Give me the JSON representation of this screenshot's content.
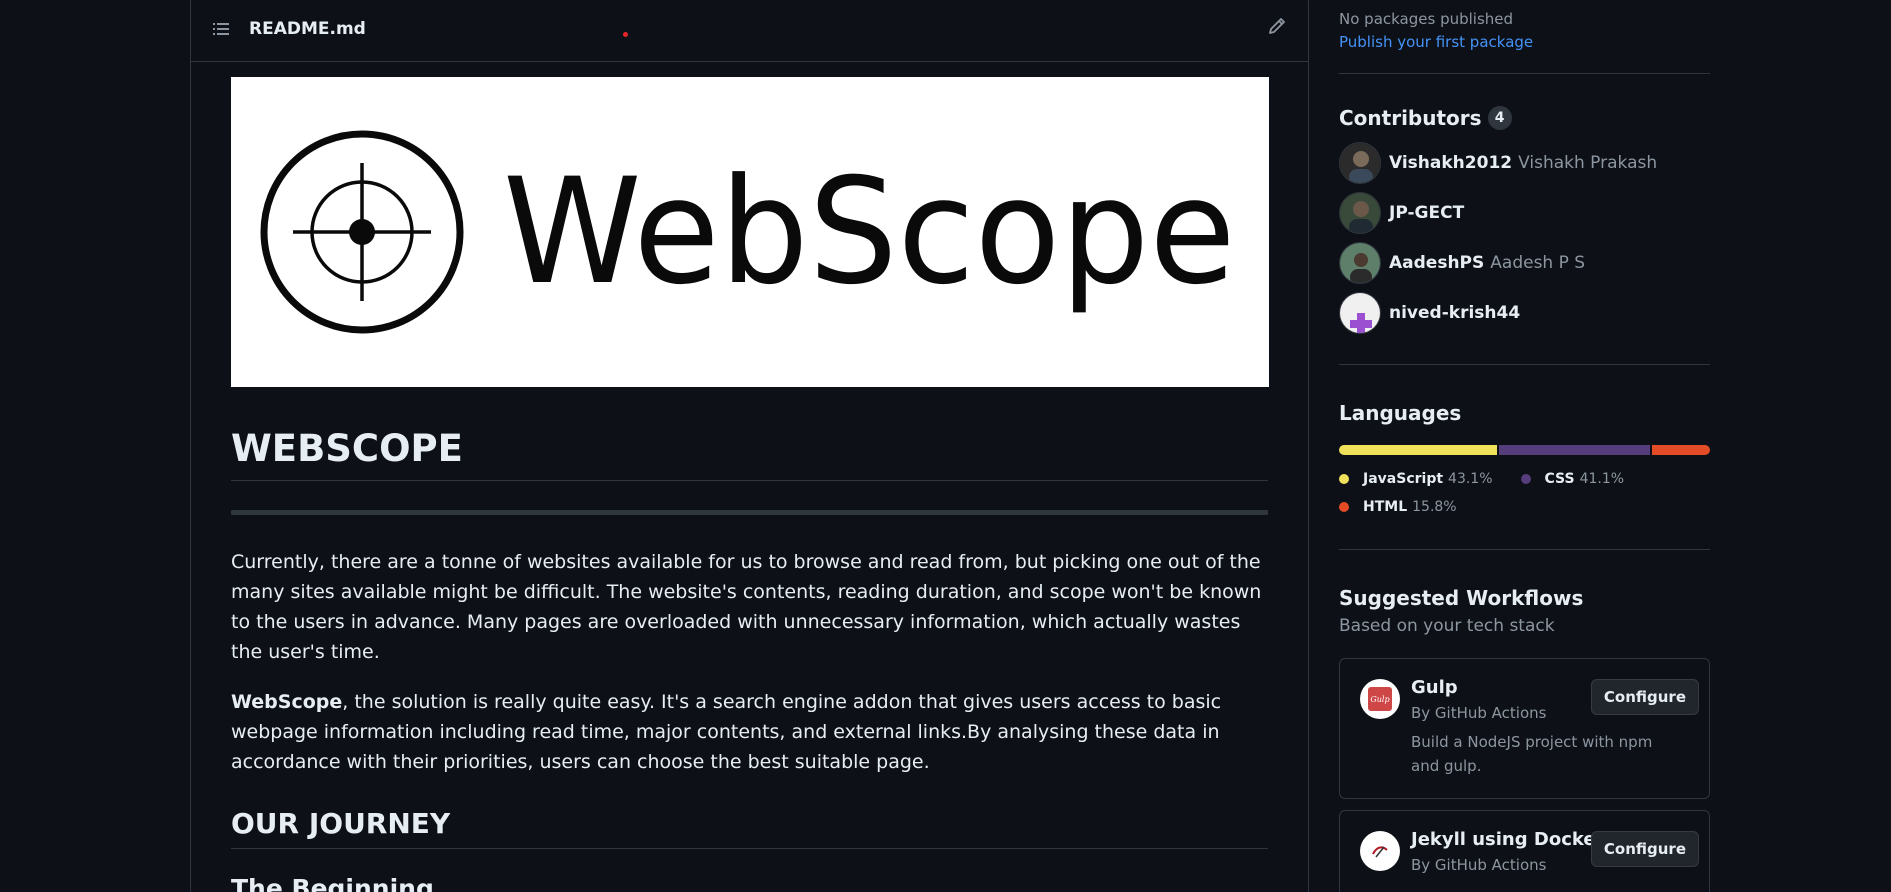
{
  "readme": {
    "filename": "README.md",
    "banner_text": "WebScope",
    "title": "WEBSCOPE",
    "para1": "Currently, there are a tonne of websites available for us to browse and read from, but picking one out of the many sites available might be difficult. The website's contents, reading duration, and scope won't be known to the users in advance. Many pages are overloaded with unnecessary information, which actually wastes the user's time.",
    "para2_bold": "WebScope",
    "para2_rest": ", the solution is really quite easy. It's a search engine addon that gives users access to basic webpage information including read time, major contents, and external links.By analysing these data in accordance with their priorities, users can choose the best suitable page.",
    "h2_journey": "OUR JOURNEY",
    "h3_beginning": "The Beginning"
  },
  "sidebar": {
    "packages": {
      "none_text": "No packages published",
      "publish_link": "Publish your first package"
    },
    "contributors": {
      "title": "Contributors",
      "count": "4",
      "items": [
        {
          "login": "Vishakh2012",
          "name": "Vishakh Prakash"
        },
        {
          "login": "JP-GECT",
          "name": ""
        },
        {
          "login": "AadeshPS",
          "name": "Aadesh P S"
        },
        {
          "login": "nived-krish44",
          "name": ""
        }
      ]
    },
    "languages": {
      "title": "Languages",
      "items": [
        {
          "name": "JavaScript",
          "pct": "43.1%",
          "value": 43.1,
          "color": "#f1e05a"
        },
        {
          "name": "CSS",
          "pct": "41.1%",
          "value": 41.1,
          "color": "#563d7c"
        },
        {
          "name": "HTML",
          "pct": "15.8%",
          "value": 15.8,
          "color": "#e34c26"
        }
      ]
    },
    "workflows": {
      "title": "Suggested Workflows",
      "subtitle": "Based on your tech stack",
      "items": [
        {
          "name": "Gulp",
          "by": "By GitHub Actions",
          "desc": "Build a NodeJS project with npm and gulp.",
          "button": "Configure",
          "icon_text": "Gulp"
        },
        {
          "name": "Jekyll using Docker",
          "by": "By GitHub Actions",
          "desc": "",
          "button": "Configure"
        }
      ]
    }
  }
}
